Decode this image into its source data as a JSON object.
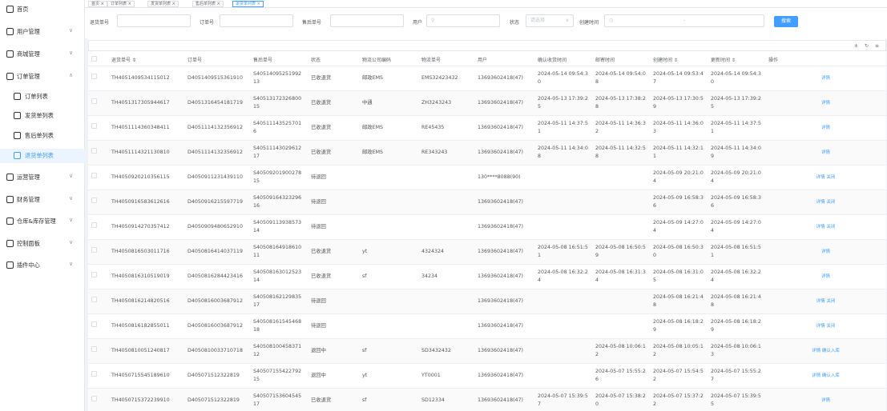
{
  "sidebar": {
    "items": [
      {
        "label": "首页",
        "icon": "home-icon",
        "chev": ""
      },
      {
        "label": "用户管理",
        "icon": "user-icon",
        "chev": "∨"
      },
      {
        "label": "商城管理",
        "icon": "shop-icon",
        "chev": "∨"
      },
      {
        "label": "订单管理",
        "icon": "order-icon",
        "chev": "∧"
      },
      {
        "label": "订单列表",
        "icon": "list-icon",
        "chev": ""
      },
      {
        "label": "发货单列表",
        "icon": "box-icon",
        "chev": ""
      },
      {
        "label": "售后单列表",
        "icon": "service-icon",
        "chev": ""
      },
      {
        "label": "退货单列表",
        "icon": "return-icon",
        "chev": ""
      },
      {
        "label": "运营管理",
        "icon": "operation-icon",
        "chev": "∨"
      },
      {
        "label": "财务管理",
        "icon": "finance-icon",
        "chev": "∨"
      },
      {
        "label": "仓库&库存管理",
        "icon": "warehouse-icon",
        "chev": "∨"
      },
      {
        "label": "控制面板",
        "icon": "dashboard-icon",
        "chev": "∨"
      },
      {
        "label": "插件中心",
        "icon": "plugin-icon",
        "chev": "∨"
      }
    ]
  },
  "tabs": [
    "首页 ×",
    "订单列表 ×",
    "发货单列表 ×",
    "售后单列表 ×",
    "退货单列表 ×"
  ],
  "filters": {
    "return_no_label": "退货单号",
    "order_no_label": "订单号",
    "after_no_label": "售后单号",
    "user_label": "用户",
    "user_icon": "user-icon",
    "user_value": "",
    "status_label": "状态",
    "status_placeholder": "请选择",
    "status_chevron": "∨",
    "created_label": "创建时间",
    "created_icon": "clock-icon",
    "created_sep": "-",
    "search_label": "搜索"
  },
  "toolbar": {
    "icons": [
      "±",
      "↻",
      "≡"
    ]
  },
  "table": {
    "headers": [
      "",
      "退货单号 ⇕",
      "订单号",
      "售后单号",
      "状态",
      "物流公司编码",
      "物流单号",
      "用户",
      "确认收货时间",
      "邮寄时间",
      "创建时间 ⇕",
      "更新时间 ⇕",
      "操作"
    ],
    "rows": [
      [
        "",
        "TH4051409534115012",
        "D4051409515361910",
        "S40514095251992 13",
        "已收退货",
        "邮政EMS",
        "EMS32423432",
        "13693602418(47)",
        "2024-05-14 09:54:3 0",
        "2024-05-14 09:54:0 8",
        "2024-05-14 09:53:4 7",
        "2024-05-14 09:54:3 0",
        "详情"
      ],
      [
        "",
        "TH4051317305944617",
        "D4051316454181719",
        "S40513172326800 15",
        "已收退货",
        "中通",
        "ZH3243243",
        "13693602418(47)",
        "2024-05-13 17:39:2 5",
        "2024-05-13 17:38:2 8",
        "2024-05-13 17:30:5 9",
        "2024-05-13 17:39:2 5",
        "详情"
      ],
      [
        "",
        "TH4051114360348411",
        "D4051114132356912",
        "S40511143525701 6",
        "已收退货",
        "邮政EMS",
        "RE45435",
        "13693602418(47)",
        "2024-05-11 14:37:5 1",
        "2024-05-11 14:36:3 2",
        "2024-05-11 14:36:0 3",
        "2024-05-11 14:37:5 1",
        "详情"
      ],
      [
        "",
        "TH4051114321130810",
        "D4051114132356912",
        "S40511143029612 17",
        "已收退货",
        "邮政EMS",
        "RE343243",
        "13693602418(47)",
        "2024-05-11 14:34:0 8",
        "2024-05-11 14:32:5 8",
        "2024-05-11 14:32:1 1",
        "2024-05-11 14:34:0 9",
        "详情"
      ],
      [
        "",
        "TH4050920210356115",
        "D4050911231439110",
        "S40509201900278 15",
        "待退回",
        "",
        "",
        "130****8088(90)",
        "",
        "",
        "2024-05-09 20:21:0 4",
        "2024-05-09 20:21:0 4",
        "详情 关闭"
      ],
      [
        "",
        "TH4050916583612616",
        "D4050916215597719",
        "S40509164323296 16",
        "待退回",
        "",
        "",
        "13693602418(47)",
        "",
        "",
        "2024-05-09 16:58:3 6",
        "2024-05-09 16:58:3 6",
        "详情 关闭"
      ],
      [
        "",
        "TH4050914270357412",
        "D4050909480652910",
        "S40509113938573 14",
        "待退回",
        "",
        "",
        "13693602418(47)",
        "",
        "",
        "2024-05-09 14:27:0 4",
        "2024-05-09 14:27:0 4",
        "详情 关闭"
      ],
      [
        "",
        "TH4050816503011716",
        "D4050816414037119",
        "S40508164918610 11",
        "已收退货",
        "yt",
        "4324324",
        "13693602418(47)",
        "2024-05-08 16:51:5 1",
        "2024-05-08 16:50:5 9",
        "2024-05-08 16:50:3 0",
        "2024-05-08 16:51:5 1",
        "详情"
      ],
      [
        "",
        "TH4050816310519019",
        "D4050816284423416",
        "S40508163012523 14",
        "已收退货",
        "sf",
        "34234",
        "13693602418(47)",
        "2024-05-08 16:32:2 4",
        "2024-05-08 16:31:3 4",
        "2024-05-08 16:31:0 5",
        "2024-05-08 16:32:2 4",
        "详情"
      ],
      [
        "",
        "TH4050816214820516",
        "D4050816003687912",
        "S40508162129835 17",
        "待退回",
        "",
        "",
        "13693602418(47)",
        "",
        "",
        "2024-05-08 16:21:4 8",
        "2024-05-08 16:21:4 8",
        "详情 关闭"
      ],
      [
        "",
        "TH4050816182855011",
        "D4050816003687912",
        "S40508161545468 18",
        "待退回",
        "",
        "",
        "13693602418(47)",
        "",
        "",
        "2024-05-08 16:18:2 9",
        "2024-05-08 16:18:2 9",
        "详情 关闭"
      ],
      [
        "",
        "TH4050810051240817",
        "D4050810033710718",
        "S40508100458371 12",
        "退回中",
        "sf",
        "SD3432432",
        "13693602418(47)",
        "",
        "2024-05-08 10:06:1 2",
        "2024-05-08 10:05:1 2",
        "2024-05-08 10:06:1 3",
        "详情 确认入库"
      ],
      [
        "",
        "TH4050715545189610",
        "D405071512322819",
        "S40507155422792 15",
        "退回中",
        "yt",
        "YT0001",
        "13693602418(47)",
        "",
        "2024-05-07 15:55:2 6",
        "2024-05-07 15:54:5 2",
        "2024-05-07 15:55:2 7",
        "详情 确认入库"
      ],
      [
        "",
        "TH4050715372239910",
        "D405071512322819",
        "S40507153604545 17",
        "已收退货",
        "sf",
        "SD12334",
        "13693602418(47)",
        "2024-05-07 15:39:5 7",
        "2024-05-07 15:38:2 0",
        "2024-05-07 15:37:2 2",
        "2024-05-07 15:39:5 5",
        "详情"
      ]
    ]
  }
}
